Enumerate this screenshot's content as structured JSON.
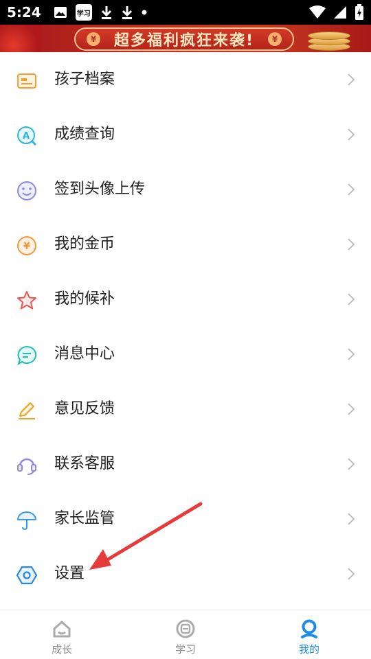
{
  "status_bar": {
    "time": "5:24",
    "app_badge": "学习"
  },
  "banner": {
    "text": "超多福利疯狂来袭!",
    "coin_symbol": "¥"
  },
  "menu": {
    "items": [
      {
        "label": "孩子档案",
        "icon": "profile-card-icon"
      },
      {
        "label": "成绩查询",
        "icon": "score-search-icon"
      },
      {
        "label": "签到头像上传",
        "icon": "smiley-face-icon"
      },
      {
        "label": "我的金币",
        "icon": "coin-icon"
      },
      {
        "label": "我的候补",
        "icon": "star-icon"
      },
      {
        "label": "消息中心",
        "icon": "message-bubble-icon"
      },
      {
        "label": "意见反馈",
        "icon": "pencil-icon"
      },
      {
        "label": "联系客服",
        "icon": "headset-icon"
      },
      {
        "label": "家长监管",
        "icon": "umbrella-icon"
      },
      {
        "label": "设置",
        "icon": "settings-hexagon-icon"
      }
    ]
  },
  "bottom_nav": {
    "tabs": [
      {
        "label": "成长",
        "icon": "home-icon",
        "active": false
      },
      {
        "label": "学习",
        "icon": "study-icon",
        "active": false
      },
      {
        "label": "我的",
        "icon": "person-icon",
        "active": true
      }
    ]
  },
  "colors": {
    "accent": "#1a8cf0",
    "annotation_arrow": "#e63b3b"
  }
}
